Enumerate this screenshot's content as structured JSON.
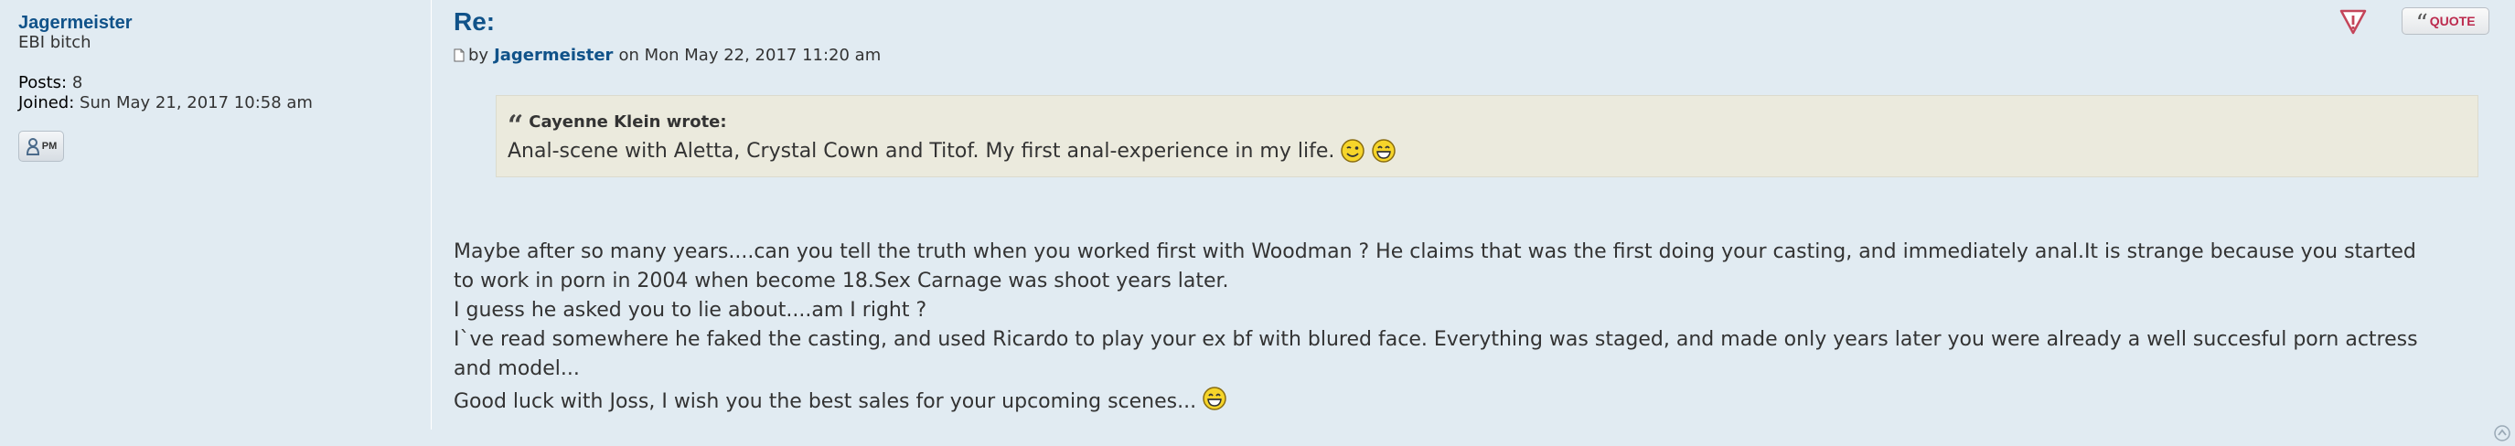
{
  "author": {
    "name": "Jagermeister",
    "rank": "EBI bitch",
    "posts_label": "Posts:",
    "posts_value": "8",
    "joined_label": "Joined:",
    "joined_value": "Sun May 21, 2017 10:58 am",
    "pm_label": "PM"
  },
  "post": {
    "title": "Re:",
    "by_prefix": "by",
    "by_author": "Jagermeister",
    "date": "on Mon May 22, 2017 11:20 am",
    "quote_button": "QUOTE",
    "quote": {
      "cite": "Cayenne Klein wrote:",
      "text": "Anal-scene with Aletta, Crystal Cown and Titof. My first anal-experience in my life."
    },
    "lines": [
      "Maybe after so many years....can you tell the truth when you worked first with Woodman ? He claims that was the first doing your casting, and immediately anal.It is strange because you started",
      "to work in porn in 2004 when become 18.Sex Carnage was shoot years later.",
      "I guess he asked you to lie about....am I right ?",
      "I`ve read somewhere he faked the casting, and used Ricardo to play your ex bf with blured face. Everything was staged, and made only years later you were already a well succesful porn actress",
      "and model...",
      "Good luck with Joss, I wish you the best sales for your upcoming scenes..."
    ]
  },
  "icons": {
    "post_icon": "document-icon",
    "report": "report-icon",
    "quote": "quote-icon",
    "pm": "pm-icon",
    "wink": "wink-smiley-icon",
    "laugh": "laugh-smiley-icon",
    "top": "back-to-top-icon"
  },
  "colors": {
    "background": "#e1ebf2",
    "link": "#105289",
    "quote_bg": "#ebeadd",
    "quote_text_red": "#bc2a4d"
  }
}
